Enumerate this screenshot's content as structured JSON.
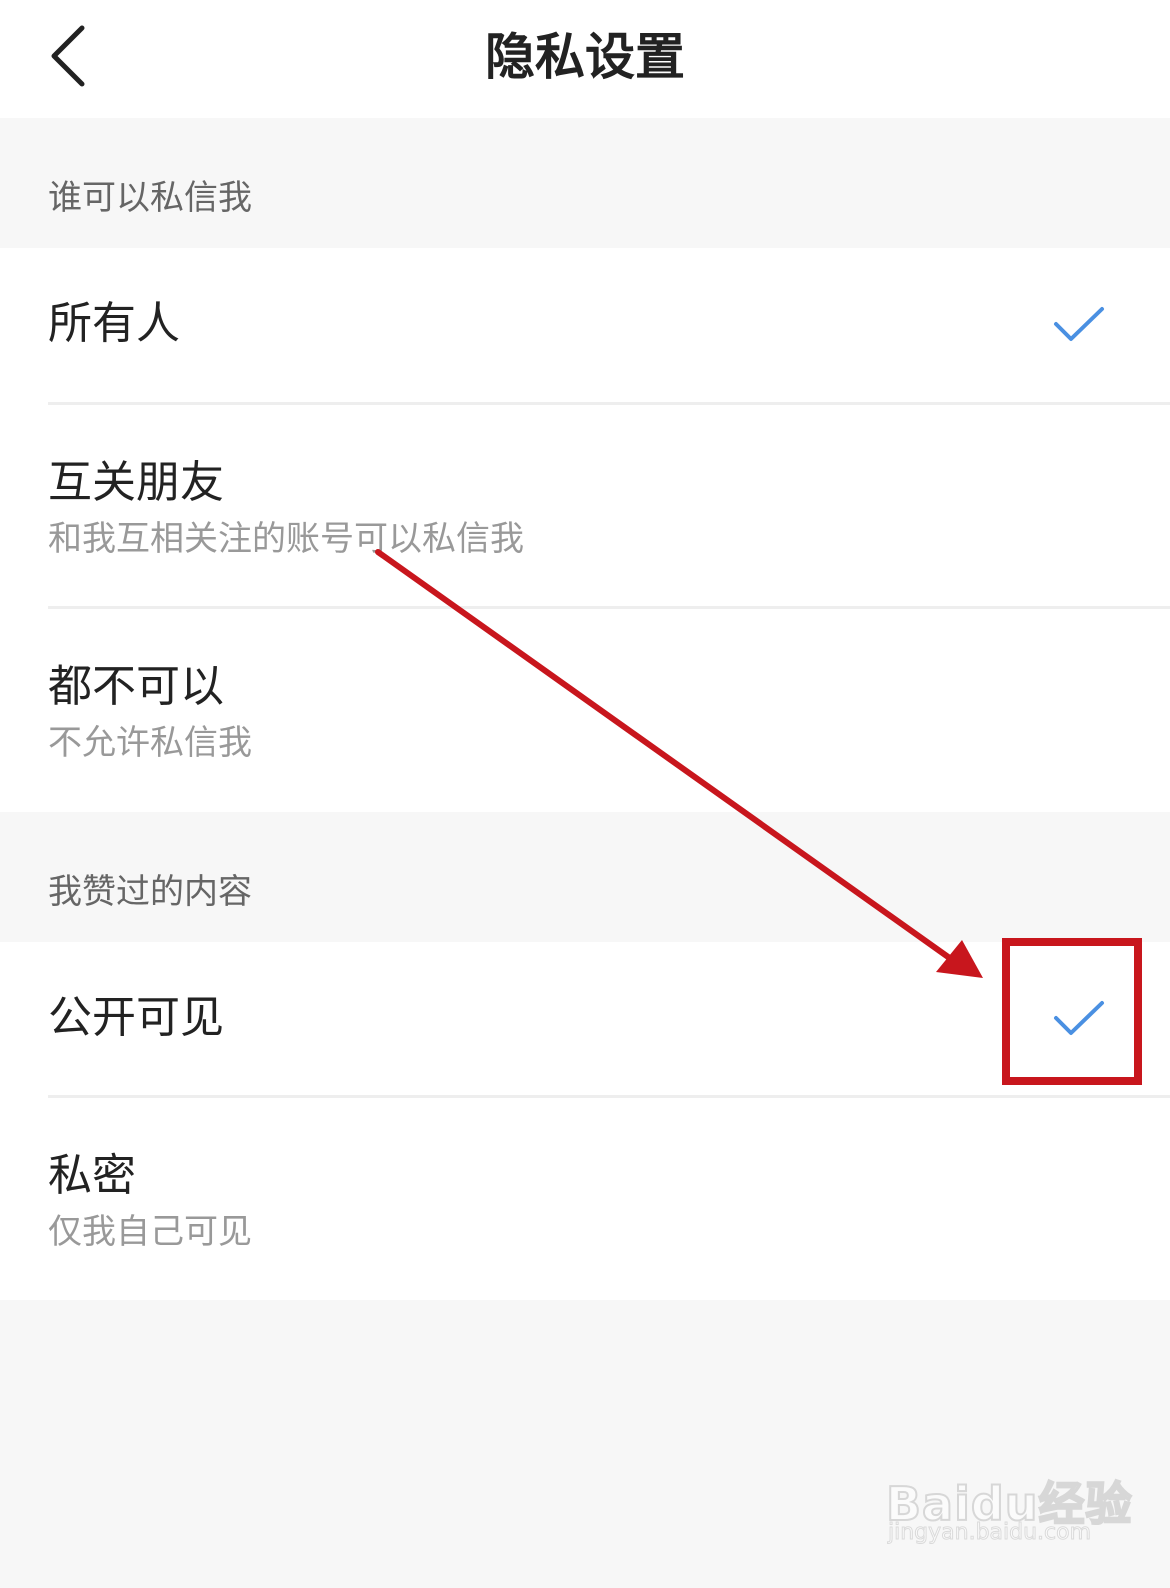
{
  "header": {
    "title": "隐私设置",
    "back_icon": "chevron-left-icon"
  },
  "sections": [
    {
      "header": "谁可以私信我",
      "options": [
        {
          "title": "所有人",
          "subtitle": "",
          "selected": true
        },
        {
          "title": "互关朋友",
          "subtitle": "和我互相关注的账号可以私信我",
          "selected": false
        },
        {
          "title": "都不可以",
          "subtitle": "不允许私信我",
          "selected": false
        }
      ]
    },
    {
      "header": "我赞过的内容",
      "options": [
        {
          "title": "公开可见",
          "subtitle": "",
          "selected": true
        },
        {
          "title": "私密",
          "subtitle": "仅我自己可见",
          "selected": false
        }
      ]
    }
  ],
  "colors": {
    "check": "#4a90e2",
    "annotation": "#c8161d",
    "background": "#f7f7f7"
  },
  "watermark": {
    "logo": "Baidu经验",
    "url": "jingyan.baidu.com"
  }
}
